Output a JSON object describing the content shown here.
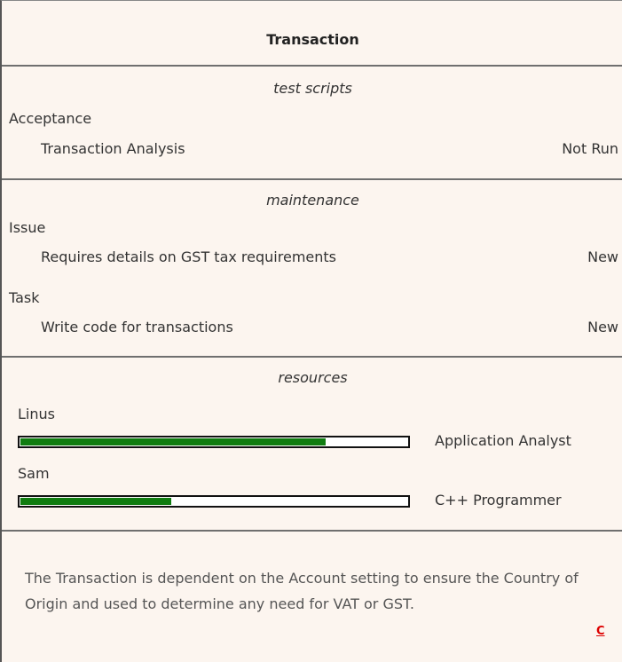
{
  "title": "Transaction",
  "test_scripts": {
    "heading": "test scripts",
    "groups": [
      {
        "name": "Acceptance",
        "items": [
          {
            "label": "Transaction Analysis",
            "status": "Not Run"
          }
        ]
      }
    ]
  },
  "maintenance": {
    "heading": "maintenance",
    "groups": [
      {
        "name": "Issue",
        "items": [
          {
            "label": "Requires details on GST tax requirements",
            "status": "New"
          }
        ]
      },
      {
        "name": "Task",
        "items": [
          {
            "label": "Write code for transactions",
            "status": "New"
          }
        ]
      }
    ]
  },
  "resources": {
    "heading": "resources",
    "items": [
      {
        "name": "Linus",
        "role": "Application Analyst",
        "progress_fraction": 0.79
      },
      {
        "name": "Sam",
        "role": "C++ Programmer",
        "progress_fraction": 0.39
      }
    ]
  },
  "notes": {
    "text": "The Transaction is dependent on the Account setting to ensure the Country of Origin and used to determine any need for VAT or GST.",
    "link_label": "C"
  },
  "colors": {
    "background": "#fcf5ef",
    "progress": "#107c10",
    "link": "#dd0000"
  }
}
